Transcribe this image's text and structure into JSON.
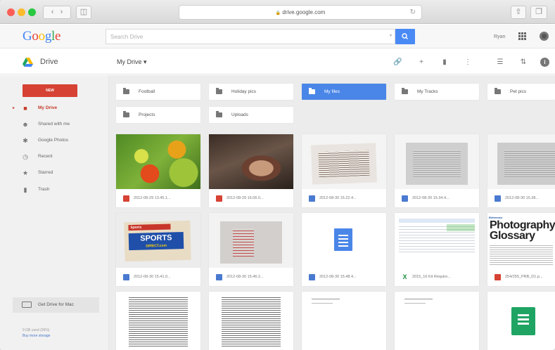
{
  "browser": {
    "url": "drive.google.com"
  },
  "header": {
    "logo": "Google",
    "search_placeholder": "Search Drive",
    "user_name": "Ryan"
  },
  "drive_bar": {
    "app_label": "Drive",
    "location": "My Drive ▾"
  },
  "sidebar": {
    "new_label": "NEW",
    "items": [
      {
        "label": "My Drive",
        "icon": "drive-folder-icon",
        "active": true
      },
      {
        "label": "Shared with me",
        "icon": "people-icon"
      },
      {
        "label": "Google Photos",
        "icon": "pinwheel-icon"
      },
      {
        "label": "Recent",
        "icon": "clock-icon"
      },
      {
        "label": "Starred",
        "icon": "star-icon"
      },
      {
        "label": "Trash",
        "icon": "trash-icon"
      }
    ],
    "get_drive": "Get Drive for Mac",
    "storage_used": "9 GB used (36%)",
    "buy_storage": "Buy more storage"
  },
  "folders": [
    {
      "name": "Football",
      "selected": false
    },
    {
      "name": "Holiday pics",
      "selected": false
    },
    {
      "name": "My files",
      "selected": true
    },
    {
      "name": "My Tracks",
      "selected": false
    },
    {
      "name": "Pet pics",
      "selected": false
    },
    {
      "name": "Projects",
      "selected": false
    },
    {
      "name": "Uploads",
      "selected": false
    }
  ],
  "files": [
    {
      "title": "2012-08-29 13.45.1...",
      "type": "image",
      "thumb": "flowers"
    },
    {
      "title": "2012-08-29 16.06.0...",
      "type": "image",
      "thumb": "boy"
    },
    {
      "title": "2012-08-30 15.22.4...",
      "type": "doc",
      "thumb": "page-photo"
    },
    {
      "title": "2012-08-30 15.34.4...",
      "type": "doc",
      "thumb": "page-gray"
    },
    {
      "title": "2012-08-30 15.38...",
      "type": "doc",
      "thumb": "page-gray"
    },
    {
      "title": "2012-08-30 15.41.0...",
      "type": "doc",
      "thumb": "sports"
    },
    {
      "title": "2012-08-30 15.46.2...",
      "type": "doc",
      "thumb": "page-photo2"
    },
    {
      "title": "2012-08-30 15.48.4...",
      "type": "doc",
      "thumb": "doc-icon"
    },
    {
      "title": "2015_16 Kit Require...",
      "type": "sheet",
      "thumb": "spreadsheet"
    },
    {
      "title": "254/255_PRB_D1.p...",
      "type": "pdf",
      "thumb": "glossary",
      "thumb_text": [
        "Reference",
        "Photography",
        "Glossary"
      ]
    },
    {
      "title": "",
      "type": "doc",
      "thumb": "text-page"
    },
    {
      "title": "",
      "type": "doc",
      "thumb": "text-page"
    },
    {
      "title": "",
      "type": "doc",
      "thumb": "blank-page"
    },
    {
      "title": "",
      "type": "doc",
      "thumb": "blank-page"
    },
    {
      "title": "",
      "type": "sheet",
      "thumb": "sheet-icon"
    }
  ],
  "thumb_texts": {
    "sports_top": "Sports",
    "sports_main": "SPORTS",
    "sports_sub": "DIRECT.com"
  },
  "colors": {
    "new_button": "#d64233",
    "selected_folder": "#4a86e8",
    "search_button": "#4a8af4"
  }
}
